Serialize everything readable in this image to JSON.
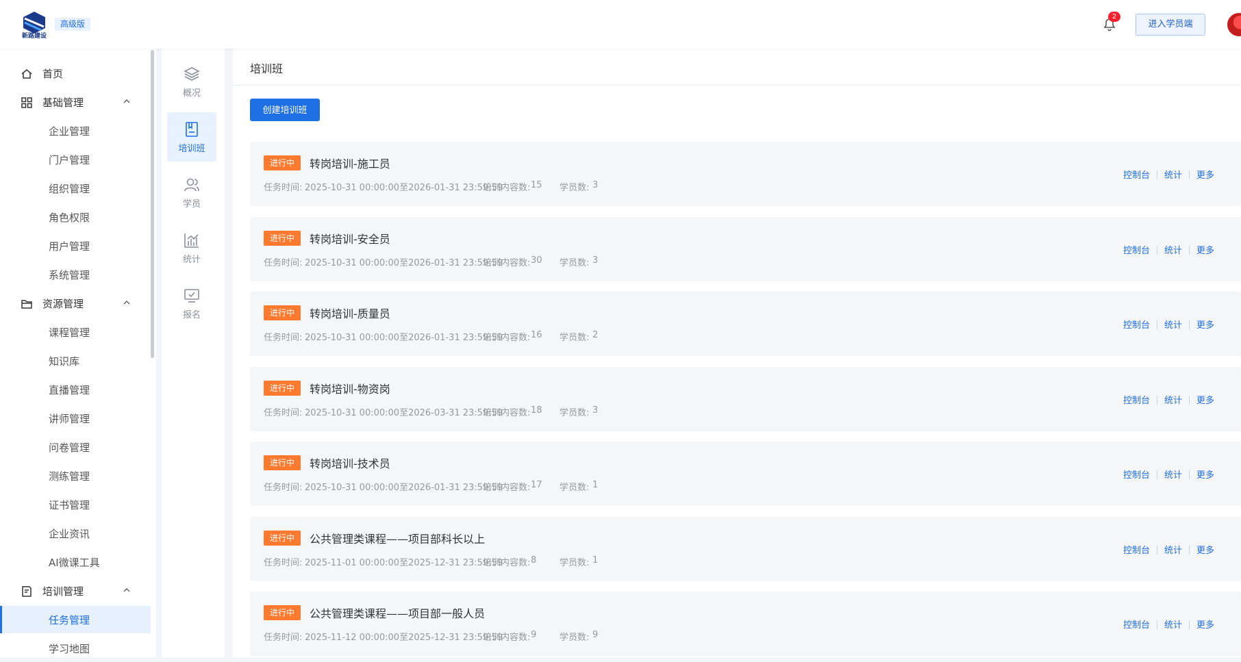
{
  "header": {
    "logo_text": "新路建设",
    "version": "高级版",
    "notification_count": "2",
    "enter_student_label": "进入学员端"
  },
  "sidebar": {
    "home": "首页",
    "groups": [
      {
        "label": "基础管理",
        "items": [
          "企业管理",
          "门户管理",
          "组织管理",
          "角色权限",
          "用户管理",
          "系统管理"
        ]
      },
      {
        "label": "资源管理",
        "items": [
          "课程管理",
          "知识库",
          "直播管理",
          "讲师管理",
          "问卷管理",
          "测练管理",
          "证书管理",
          "企业资讯",
          "AI微课工具"
        ]
      },
      {
        "label": "培训管理",
        "items": [
          "任务管理",
          "学习地图"
        ]
      }
    ],
    "active_item": "任务管理"
  },
  "rail": {
    "items": [
      "概况",
      "培训班",
      "学员",
      "统计",
      "报名"
    ],
    "active": "培训班"
  },
  "main": {
    "title": "培训班",
    "create_label": "创建培训班",
    "time_label": "任务时间:",
    "content_label": "培训内容数:",
    "students_label": "学员数:",
    "actions": [
      "控制台",
      "统计",
      "更多"
    ],
    "classes": [
      {
        "status": "进行中",
        "name": "转岗培训-施工员",
        "time": "2025-10-31 00:00:00至2026-01-31 23:59:59",
        "content": "15",
        "students": "3"
      },
      {
        "status": "进行中",
        "name": "转岗培训-安全员",
        "time": "2025-10-31 00:00:00至2026-01-31 23:59:59",
        "content": "30",
        "students": "3"
      },
      {
        "status": "进行中",
        "name": "转岗培训-质量员",
        "time": "2025-10-31 00:00:00至2026-01-31 23:59:59",
        "content": "16",
        "students": "2"
      },
      {
        "status": "进行中",
        "name": "转岗培训-物资岗",
        "time": "2025-10-31 00:00:00至2026-03-31 23:59:59",
        "content": "18",
        "students": "3"
      },
      {
        "status": "进行中",
        "name": "转岗培训-技术员",
        "time": "2025-10-31 00:00:00至2026-01-31 23:59:59",
        "content": "17",
        "students": "1"
      },
      {
        "status": "进行中",
        "name": "公共管理类课程——项目部科长以上",
        "time": "2025-11-01 00:00:00至2025-12-31 23:59:59",
        "content": "8",
        "students": "1"
      },
      {
        "status": "进行中",
        "name": "公共管理类课程——项目部一般人员",
        "time": "2025-11-12 00:00:00至2025-12-31 23:59:59",
        "content": "9",
        "students": "9"
      }
    ]
  }
}
